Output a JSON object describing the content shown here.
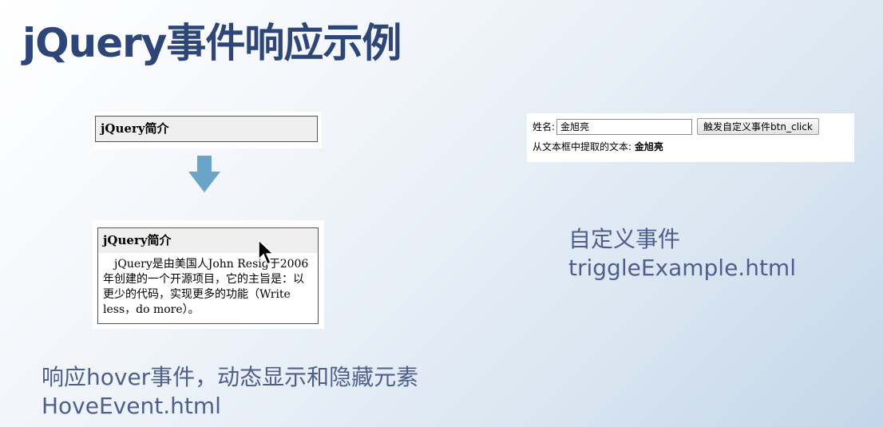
{
  "slide": {
    "title": "jQuery事件响应示例"
  },
  "hover_demo": {
    "collapsed_header": "jQuery简介",
    "expanded_header": "jQuery简介",
    "expanded_body": "jQuery是由美国人John Resig于2006年创建的一个开源项目，它的主旨是：以更少的代码，实现更多的功能（Write less，do more）。",
    "caption_line1": "响应hover事件，动态显示和隐藏元素",
    "caption_line2": "HoveEvent.html"
  },
  "custom_event_demo": {
    "name_label": "姓名:",
    "name_value": "金旭亮",
    "button_label": "触发自定义事件btn_click",
    "extract_label": "从文本框中提取的文本:",
    "extract_value": "金旭亮",
    "caption_line1": "自定义事件",
    "caption_line2": "triggleExample.html"
  },
  "icons": {
    "arrow": "down-arrow-icon",
    "cursor": "mouse-pointer-icon"
  },
  "colors": {
    "title": "#2e4677",
    "caption": "#4f5f8c",
    "arrow": "#6aa5c8"
  }
}
